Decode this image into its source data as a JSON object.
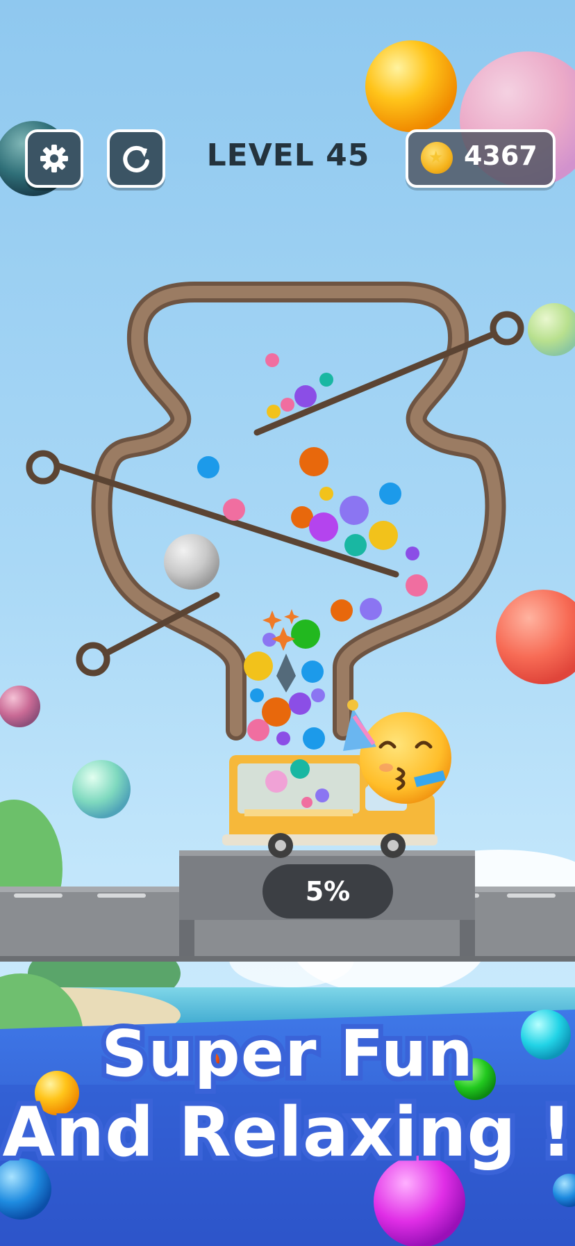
{
  "hud": {
    "settings_icon": "gear-icon",
    "restart_icon": "restart-icon",
    "level_label": "LEVEL 45",
    "coin_icon": "coin-icon",
    "coin_count": "4367"
  },
  "progress": {
    "label": "5%",
    "value_percent": 5
  },
  "promo": {
    "line1": "Super Fun",
    "line2": "And Relaxing !"
  },
  "colors": {
    "hud_button": "#3b5464",
    "wood": "#8a6a52",
    "promo_fill": "#ffffff",
    "promo_stroke": "#3a63d8",
    "progress_pill": "#3c3f44"
  }
}
